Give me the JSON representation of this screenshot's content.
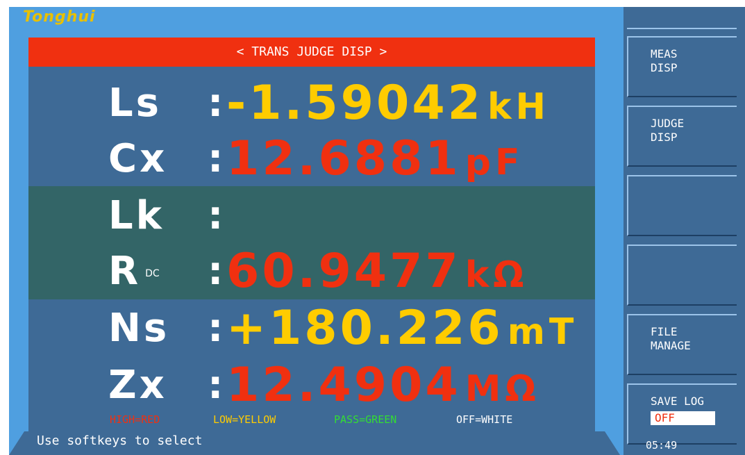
{
  "brand": "Tonghui",
  "title": "< TRANS JUDGE DISP >",
  "readings": [
    {
      "label": "Ls",
      "sub": "",
      "value": "-1.59042",
      "unit": "kH",
      "color": "#ffcc00"
    },
    {
      "label": "Cx",
      "sub": "",
      "value": " 12.6881",
      "unit": "pF",
      "color": "#f03010"
    },
    {
      "label": "Lk",
      "sub": "",
      "value": "",
      "unit": "",
      "color": "#ffffff"
    },
    {
      "label": "R",
      "sub": "DC",
      "value": " 60.9477",
      "unit": "kΩ",
      "color": "#f03010"
    },
    {
      "label": "Ns",
      "sub": "",
      "value": "+180.226",
      "unit": "mT",
      "color": "#ffcc00"
    },
    {
      "label": "Zx",
      "sub": "",
      "value": " 12.4904",
      "unit": "MΩ",
      "color": "#f03010"
    }
  ],
  "legend": {
    "high": "HIGH=RED",
    "low": "LOW=YELLOW",
    "pass": "PASS=GREEN",
    "off": "OFF=WHITE"
  },
  "colors": {
    "high": "#f03010",
    "low": "#ffcc00",
    "pass": "#33dd33",
    "off": "#ffffff"
  },
  "status": "Use softkeys to select",
  "softkeys": [
    {
      "line1": "MEAS",
      "line2": "DISP"
    },
    {
      "line1": "JUDGE",
      "line2": "DISP"
    },
    {
      "line1": "",
      "line2": ""
    },
    {
      "line1": "",
      "line2": ""
    },
    {
      "line1": "FILE",
      "line2": "MANAGE"
    },
    {
      "line1": "SAVE LOG",
      "line2": "OFF"
    }
  ],
  "time": "05:49"
}
